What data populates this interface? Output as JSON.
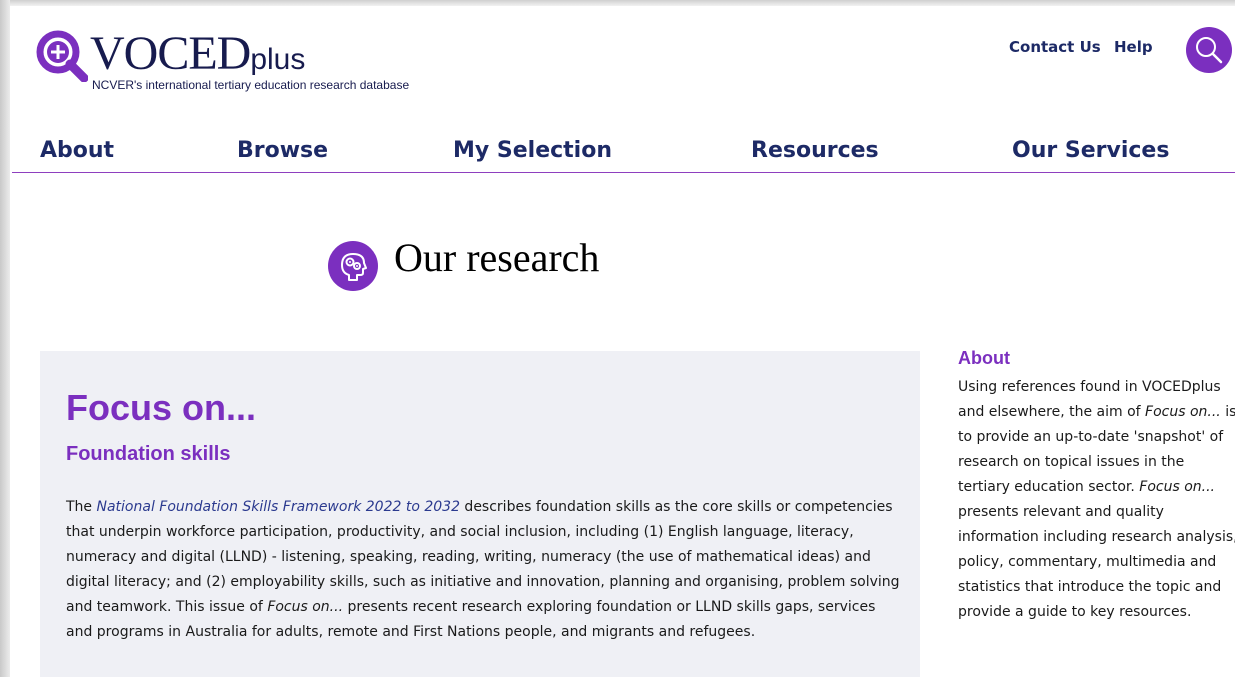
{
  "header": {
    "logo": {
      "brand_main": "VOCED",
      "brand_plus": "plus",
      "tagline": "NCVER's international tertiary education research database"
    },
    "utility_links": [
      "Contact Us",
      "Help"
    ],
    "search_icon": "search-icon"
  },
  "nav": {
    "items": [
      "About",
      "Browse",
      "My Selection",
      "Resources",
      "Our Services"
    ]
  },
  "page": {
    "title": "Our research",
    "title_icon": "head-gears-icon"
  },
  "main": {
    "heading": "Focus on...",
    "subheading": "Foundation skills",
    "body": {
      "p1": "The ",
      "link": "National Foundation Skills Framework 2022 to 2032",
      "p2": " describes foundation skills as the core skills or competencies that underpin workforce participation, productivity, and social inclusion, including (1) English language, literacy, numeracy and digital (LLND) - listening, speaking, reading, writing, numeracy (the use of mathematical ideas) and digital literacy; and (2) employability skills, such as initiative and innovation, planning and organising, problem solving and teamwork. This issue of ",
      "em": "Focus on...",
      "p3": " presents recent research exploring foundation or LLND skills gaps, services and programs in Australia for adults, remote and First Nations people, and migrants and refugees."
    }
  },
  "sidebar": {
    "title": "About",
    "p1": "Using references found in VOCEDplus and elsewhere, the aim of ",
    "em1": "Focus on...",
    "p2": " is to provide an up-to-date 'snapshot' of research on topical issues in the tertiary education sector. ",
    "em2": "Focus on...",
    "p3": " presents relevant and quality information including research analysis, policy, commentary, multimedia and statistics that introduce the topic and provide a guide to key resources."
  },
  "colors": {
    "accent": "#7b2fbf",
    "navy": "#1d2a66",
    "box_bg": "#eff0f5"
  }
}
